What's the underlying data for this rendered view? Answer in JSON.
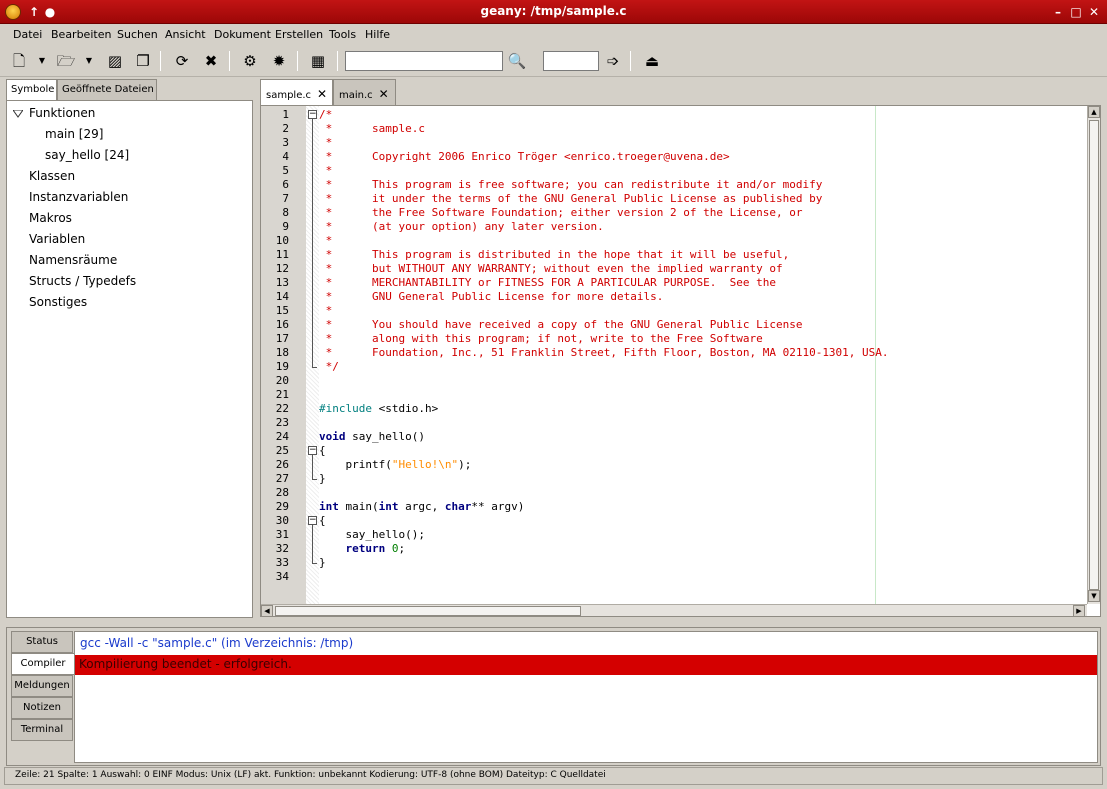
{
  "window": {
    "title": "geany: /tmp/sample.c"
  },
  "menu": [
    "Datei",
    "Bearbeiten",
    "Suchen",
    "Ansicht",
    "Dokument",
    "Erstellen",
    "Tools",
    "Hilfe"
  ],
  "toolbar": {
    "search_value": "",
    "goto_value": ""
  },
  "sidebar": {
    "tabs": [
      "Symbole",
      "Geöffnete Dateien"
    ],
    "tree": [
      {
        "label": "Funktionen",
        "level": 0,
        "expanded": true
      },
      {
        "label": "main [29]",
        "level": 1
      },
      {
        "label": "say_hello [24]",
        "level": 1
      },
      {
        "label": "Klassen",
        "level": 0
      },
      {
        "label": "Instanzvariablen",
        "level": 0
      },
      {
        "label": "Makros",
        "level": 0
      },
      {
        "label": "Variablen",
        "level": 0
      },
      {
        "label": "Namensräume",
        "level": 0
      },
      {
        "label": "Structs / Typedefs",
        "level": 0
      },
      {
        "label": "Sonstiges",
        "level": 0
      }
    ]
  },
  "editor": {
    "tabs": [
      "sample.c",
      "main.c"
    ],
    "code": [
      [
        [
          "c",
          "/*"
        ]
      ],
      [
        [
          "c",
          " *      sample.c"
        ]
      ],
      [
        [
          "c",
          " *"
        ]
      ],
      [
        [
          "c",
          " *      Copyright 2006 Enrico Tröger <enrico.troeger@uvena.de>"
        ]
      ],
      [
        [
          "c",
          " *"
        ]
      ],
      [
        [
          "c",
          " *      This program is free software; you can redistribute it and/or modify"
        ]
      ],
      [
        [
          "c",
          " *      it under the terms of the GNU General Public License as published by"
        ]
      ],
      [
        [
          "c",
          " *      the Free Software Foundation; either version 2 of the License, or"
        ]
      ],
      [
        [
          "c",
          " *      (at your option) any later version."
        ]
      ],
      [
        [
          "c",
          " *"
        ]
      ],
      [
        [
          "c",
          " *      This program is distributed in the hope that it will be useful,"
        ]
      ],
      [
        [
          "c",
          " *      but WITHOUT ANY WARRANTY; without even the implied warranty of"
        ]
      ],
      [
        [
          "c",
          " *      MERCHANTABILITY or FITNESS FOR A PARTICULAR PURPOSE.  See the"
        ]
      ],
      [
        [
          "c",
          " *      GNU General Public License for more details."
        ]
      ],
      [
        [
          "c",
          " *"
        ]
      ],
      [
        [
          "c",
          " *      You should have received a copy of the GNU General Public License"
        ]
      ],
      [
        [
          "c",
          " *      along with this program; if not, write to the Free Software"
        ]
      ],
      [
        [
          "c",
          " *      Foundation, Inc., 51 Franklin Street, Fifth Floor, Boston, MA 02110-1301, USA."
        ]
      ],
      [
        [
          "c",
          " */"
        ]
      ],
      [],
      [],
      [
        [
          "p",
          "#include"
        ],
        [
          "t",
          " <stdio.h>"
        ]
      ],
      [],
      [
        [
          "k",
          "void"
        ],
        [
          "t",
          " say_hello()"
        ]
      ],
      [
        [
          "t",
          "{"
        ]
      ],
      [
        [
          "t",
          "    printf("
        ],
        [
          "s",
          "\"Hello!\\n\""
        ],
        [
          "t",
          ");"
        ]
      ],
      [
        [
          "t",
          "}"
        ]
      ],
      [],
      [
        [
          "k",
          "int"
        ],
        [
          "t",
          " main("
        ],
        [
          "k",
          "int"
        ],
        [
          "t",
          " argc, "
        ],
        [
          "k",
          "char"
        ],
        [
          "t",
          "** argv)"
        ]
      ],
      [
        [
          "t",
          "{"
        ]
      ],
      [
        [
          "t",
          "    say_hello();"
        ]
      ],
      [
        [
          "t",
          "    "
        ],
        [
          "k",
          "return"
        ],
        [
          "t",
          " "
        ],
        [
          "n",
          "0"
        ],
        [
          "t",
          ";"
        ]
      ],
      [
        [
          "t",
          "}"
        ]
      ],
      []
    ]
  },
  "messages": {
    "tabs": [
      "Status",
      "Compiler",
      "Meldungen",
      "Notizen",
      "Terminal"
    ],
    "active_tab": "Compiler",
    "compiler_command": "gcc -Wall -c \"sample.c\" (im Verzeichnis: /tmp)",
    "compiler_result": "Kompilierung beendet - erfolgreich."
  },
  "statusbar": {
    "text": "Zeile:   21 Spalte:   1 Auswahl:    0  EINF    Modus: Unix (LF)    akt. Funktion: unbekannt    Kodierung: UTF-8 (ohne BOM)    Dateityp: C Quelldatei"
  }
}
